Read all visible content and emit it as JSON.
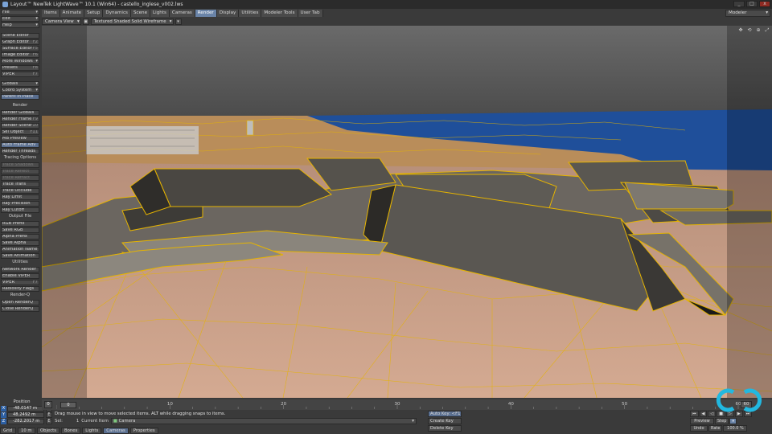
{
  "window": {
    "title": "Layout™ NewTek LightWave™ 10.1 (Win64) - castello_inglese_v002.lws",
    "controls": [
      "_",
      "□",
      "x"
    ]
  },
  "tabs": [
    {
      "label": "Items"
    },
    {
      "label": "Animate"
    },
    {
      "label": "Setup"
    },
    {
      "label": "Dynamics"
    },
    {
      "label": "Scene"
    },
    {
      "label": "Lights"
    },
    {
      "label": "Cameras"
    },
    {
      "label": "Render",
      "active": true
    },
    {
      "label": "Display"
    },
    {
      "label": "Utilities"
    },
    {
      "label": "Modeler Tools"
    },
    {
      "label": "User Tab"
    }
  ],
  "modeler_select": "Modeler",
  "left_panel": {
    "top_menus": [
      {
        "label": "File"
      },
      {
        "label": "Edit"
      },
      {
        "label": "Help"
      }
    ],
    "windows": [
      {
        "label": "Scene Editor",
        "key": ""
      },
      {
        "label": "Graph Editor",
        "key": "F2"
      },
      {
        "label": "Surface Editor",
        "key": "F5"
      },
      {
        "label": "Image Editor",
        "key": "F6"
      },
      {
        "label": "More Windows",
        "key": ""
      },
      {
        "label": "Presets",
        "key": "F8"
      },
      {
        "label": "VIPER",
        "key": "F7"
      }
    ],
    "globals": "Globals",
    "coord_system": "Coord System",
    "parent_in_place": "Parent in Place",
    "render_header": "Render",
    "render_items": [
      {
        "label": "Render Globals",
        "key": ""
      },
      {
        "label": "Render Frame",
        "key": "F9"
      },
      {
        "label": "Render Scene",
        "key": "F10"
      },
      {
        "label": "Sel Object",
        "key": "F11"
      },
      {
        "label": "MB Preview",
        "key": ""
      },
      {
        "label": "Auto Frame Adv",
        "key": "",
        "active": true
      },
      {
        "label": "Render Threads",
        "key": ""
      }
    ],
    "tracing_header": "Tracing Options",
    "tracing_items": [
      {
        "label": "Trace Shadows",
        "disabled": true
      },
      {
        "label": "Trace Reflect",
        "disabled": true
      },
      {
        "label": "Trace Refract",
        "disabled": true
      },
      {
        "label": "Trace Trans",
        "disabled": false
      },
      {
        "label": "Trace Occlude",
        "disabled": false
      },
      {
        "label": "Ray Limit",
        "disabled": false
      },
      {
        "label": "Ray Precision",
        "disabled": false
      },
      {
        "label": "Ray Cutoff",
        "disabled": false
      }
    ],
    "output_header": "Output File",
    "output_items": [
      {
        "label": "RGB Prefix"
      },
      {
        "label": "Save RGB"
      },
      {
        "label": "Alpha Prefix"
      },
      {
        "label": "Save Alpha"
      },
      {
        "label": "Animation Name"
      },
      {
        "label": "Save Animation"
      }
    ],
    "utilities_header": "Utilities",
    "utilities_items": [
      {
        "label": "Network Render"
      },
      {
        "label": "Enable VIPER"
      },
      {
        "label": "VIPER",
        "key": "F7"
      },
      {
        "label": "Radiosity Flags"
      }
    ],
    "renderq_header": "Render-Q",
    "renderq_items": [
      {
        "label": "Open RenderQ"
      },
      {
        "label": "Close RenderQ"
      }
    ]
  },
  "viewport": {
    "view_mode": "Camera View",
    "shading_mode": "Textured Shaded Solid Wireframe"
  },
  "timeline": {
    "current_frame": "0",
    "start_frame": "0",
    "end_frame": "60",
    "ticks": [
      "10",
      "20",
      "30",
      "40",
      "50",
      "60"
    ],
    "slider_label": "0"
  },
  "position": {
    "label": "Position",
    "x": "-48.0147 m",
    "y": "48.2492 m",
    "z": "-282.2017 m",
    "axis_x": "X",
    "axis_y": "Y",
    "axis_z": "Z",
    "e": "E"
  },
  "status": {
    "message": "Drag mouse in view to move selected items. ALT while dragging snaps to items.",
    "sel_label": "Sel:",
    "sel_count": "1",
    "current_item_label": "Current Item",
    "current_item": "Camera"
  },
  "keys": {
    "auto_key": "Auto Key:",
    "auto_key_val": "<F1",
    "create_key": "Create Key",
    "delete_key": "Delete Key"
  },
  "grid_row": {
    "grid_label": "Grid",
    "grid_value": "10 m",
    "objects": "Objects",
    "bones": "Bones",
    "lights": "Lights",
    "cameras": "Cameras",
    "properties": "Properties"
  },
  "transport": {
    "preview": "Preview",
    "step": "Step",
    "undo": "Undo",
    "rate_label": "Rate",
    "rate_value": "100.0 %"
  },
  "colors": {
    "accent": "#6a84a8",
    "wire": "#e6b400",
    "ground": "#c8a088",
    "sea": "#1f4f9a"
  }
}
